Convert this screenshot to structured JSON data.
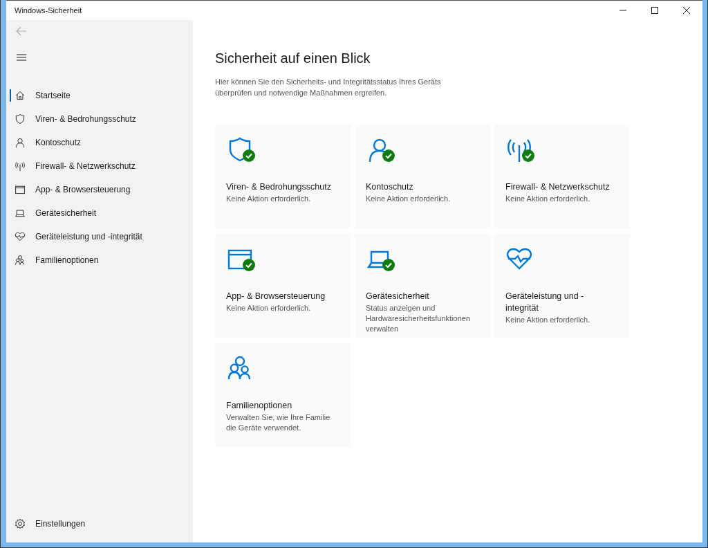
{
  "window": {
    "title": "Windows-Sicherheit"
  },
  "sidebar": {
    "items": [
      {
        "kind": "home",
        "label": "Startseite",
        "selected": true
      },
      {
        "kind": "shield",
        "label": "Viren- & Bedrohungsschutz",
        "selected": false
      },
      {
        "kind": "person",
        "label": "Kontoschutz",
        "selected": false
      },
      {
        "kind": "antenna",
        "label": "Firewall- & Netzwerkschutz",
        "selected": false
      },
      {
        "kind": "window",
        "label": "App- & Browsersteuerung",
        "selected": false
      },
      {
        "kind": "laptop",
        "label": "Gerätesicherheit",
        "selected": false
      },
      {
        "kind": "heart",
        "label": "Geräteleistung und -integrität",
        "selected": false
      },
      {
        "kind": "family",
        "label": "Familienoptionen",
        "selected": false
      }
    ],
    "settings": "Einstellungen"
  },
  "main": {
    "title": "Sicherheit auf einen Blick",
    "description": "Hier können Sie den Sicherheits- und Integritätsstatus Ihres Geräts überprüfen und notwendige Maßnahmen ergreifen.",
    "cards": [
      {
        "kind": "shield",
        "title": "Viren- & Bedrohungsschutz",
        "status": "Keine Aktion erforderlich.",
        "ok": true
      },
      {
        "kind": "person",
        "title": "Kontoschutz",
        "status": "Keine Aktion erforderlich.",
        "ok": true
      },
      {
        "kind": "antenna",
        "title": "Firewall- & Netzwerkschutz",
        "status": "Keine Aktion erforderlich.",
        "ok": true
      },
      {
        "kind": "window",
        "title": "App- & Browsersteuerung",
        "status": "Keine Aktion erforderlich.",
        "ok": true
      },
      {
        "kind": "laptop",
        "title": "Gerätesicherheit",
        "status": "Status anzeigen und Hardwaresicherheitsfunktionen verwalten",
        "ok": true
      },
      {
        "kind": "heart",
        "title": "Geräteleistung und - integrität",
        "status": "Keine Aktion erforderlich.",
        "ok": false
      },
      {
        "kind": "family",
        "title": "Familienoptionen",
        "status": "Verwalten Sie, wie Ihre Familie die Geräte verwendet.",
        "ok": false
      }
    ]
  }
}
